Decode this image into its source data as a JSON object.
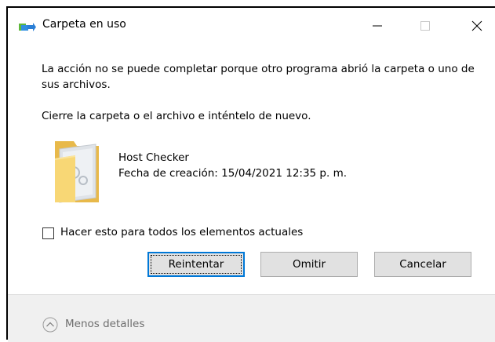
{
  "window": {
    "title": "Carpeta en uso"
  },
  "message": {
    "line1": "La acción no se puede completar porque otro programa abrió la carpeta o uno de sus archivos.",
    "line2": "Cierre la carpeta o el archivo e inténtelo de nuevo."
  },
  "file": {
    "name": "Host Checker",
    "created": "Fecha de creación: 15/04/2021 12:35 p. m.",
    "icon": "folder-icon"
  },
  "checkbox": {
    "label": "Hacer esto para todos los elementos actuales",
    "checked": false
  },
  "buttons": {
    "retry": "Reintentar",
    "skip": "Omitir",
    "cancel": "Cancelar"
  },
  "footer": {
    "details": "Menos detalles",
    "icon": "chevron-up-icon"
  },
  "colors": {
    "accent": "#0078d7",
    "folder": "#f8d775"
  }
}
